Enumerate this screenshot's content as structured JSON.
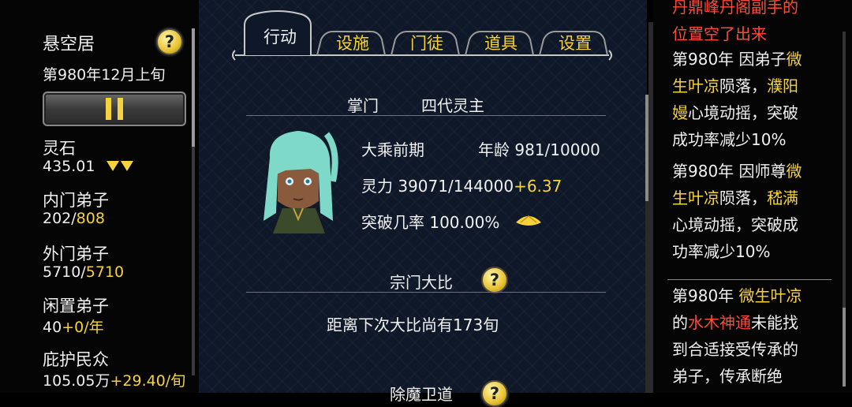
{
  "sidebar": {
    "location": "悬空居",
    "date": "第980年12月上旬",
    "stats": [
      {
        "label": "灵石",
        "value": "435.01",
        "suffix": ""
      },
      {
        "label": "内门弟子",
        "value": "202/",
        "suffix": "808"
      },
      {
        "label": "外门弟子",
        "value": "5710/",
        "suffix": "5710"
      },
      {
        "label": "闲置弟子",
        "value": "40",
        "suffix": "+0/年"
      },
      {
        "label": "庇护民众",
        "value": "105.05万",
        "suffix": "+29.40/旬"
      }
    ]
  },
  "tabs": [
    {
      "label": "行动"
    },
    {
      "label": "设施"
    },
    {
      "label": "门徒"
    },
    {
      "label": "道具"
    },
    {
      "label": "设置"
    }
  ],
  "sect_leader": {
    "header_label": "掌门",
    "header_value": "四代灵主",
    "realm": "大乘前期",
    "age_label": "年龄",
    "age_value": "981/10000",
    "qi_label": "灵力",
    "qi_value": "39071/144000",
    "qi_rate": "+6.37",
    "break_label": "突破几率",
    "break_value": "100.00%"
  },
  "tournament": {
    "title": "宗门大比",
    "countdown": "距离下次大比尚有173旬"
  },
  "next_section": {
    "title": "除魔卫道"
  },
  "event_log": {
    "top_fragment_line1": "丹鼎峰丹阁副手的",
    "top_fragment_line2": "位置空了出来",
    "entry1": {
      "l1a": "第980年 因弟子",
      "l1b": "微",
      "l2a": "生叶凉",
      "l2b": "陨落，",
      "l2c": "濮阳",
      "l3a": "嫚",
      "l3b": "心境动摇，突破",
      "l4": "成功率减少10%"
    },
    "entry2": {
      "l1a": "第980年 因师尊",
      "l1b": "微",
      "l2a": "生叶凉",
      "l2b": "陨落，",
      "l2c": "嵇满",
      "l3": "心境动摇，突破成",
      "l4": "功率减少10%"
    },
    "entry3": {
      "l1a": "第980年 ",
      "l1b": "微生叶凉",
      "l2a": "的",
      "l2b": "水木神通",
      "l2c": "未能找",
      "l3": "到合适接受传承的",
      "l4": "弟子，传承断绝"
    }
  },
  "colors": {
    "accent": "#f6d23c",
    "alert": "#ff4a3a",
    "panel_bg": "#0f1828"
  },
  "icons": [
    "help-icon",
    "pause-icon",
    "decrease-arrows-icon",
    "yellow-lotus-icon"
  ]
}
